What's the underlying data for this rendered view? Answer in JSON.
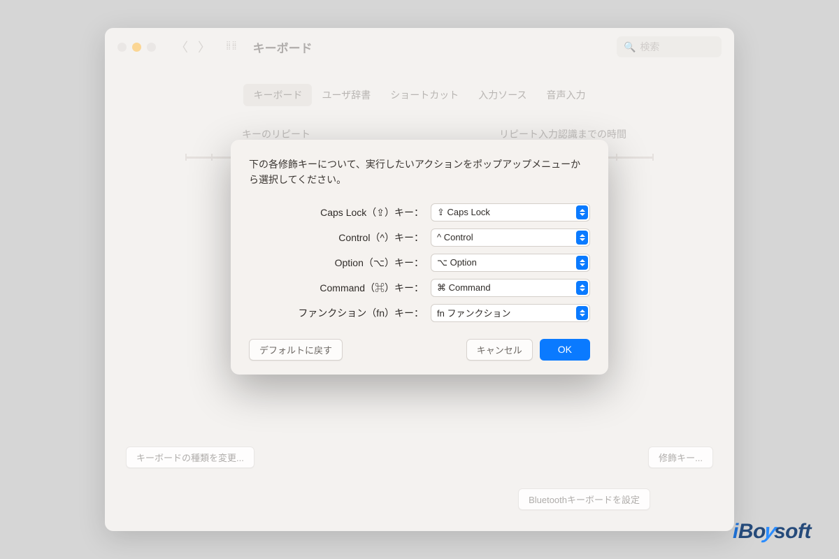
{
  "window": {
    "title": "キーボード",
    "search_placeholder": "検索"
  },
  "tabs": [
    "キーボード",
    "ユーザ辞書",
    "ショートカット",
    "入力ソース",
    "音声入力"
  ],
  "sliders": {
    "repeat": "キーのリピート",
    "delay": "リピート入力認識までの時間"
  },
  "bottom": {
    "change_type": "キーボードの種類を変更...",
    "modifier": "修飾キー...",
    "bluetooth": "Bluetoothキーボードを設定"
  },
  "dialog": {
    "instruction": "下の各修飾キーについて、実行したいアクションをポップアップメニューから選択してください。",
    "rows": [
      {
        "label": "Caps Lock（⇪）キー：",
        "value": "⇪ Caps Lock"
      },
      {
        "label": "Control（^）キー：",
        "value": "^ Control"
      },
      {
        "label": "Option（⌥）キー：",
        "value": "⌥ Option"
      },
      {
        "label": "Command（⌘）キー：",
        "value": "⌘ Command"
      },
      {
        "label": "ファンクション（fn）キー：",
        "value": "fn ファンクション"
      }
    ],
    "restore": "デフォルトに戻す",
    "cancel": "キャンセル",
    "ok": "OK"
  },
  "watermark": "iBoysoft"
}
